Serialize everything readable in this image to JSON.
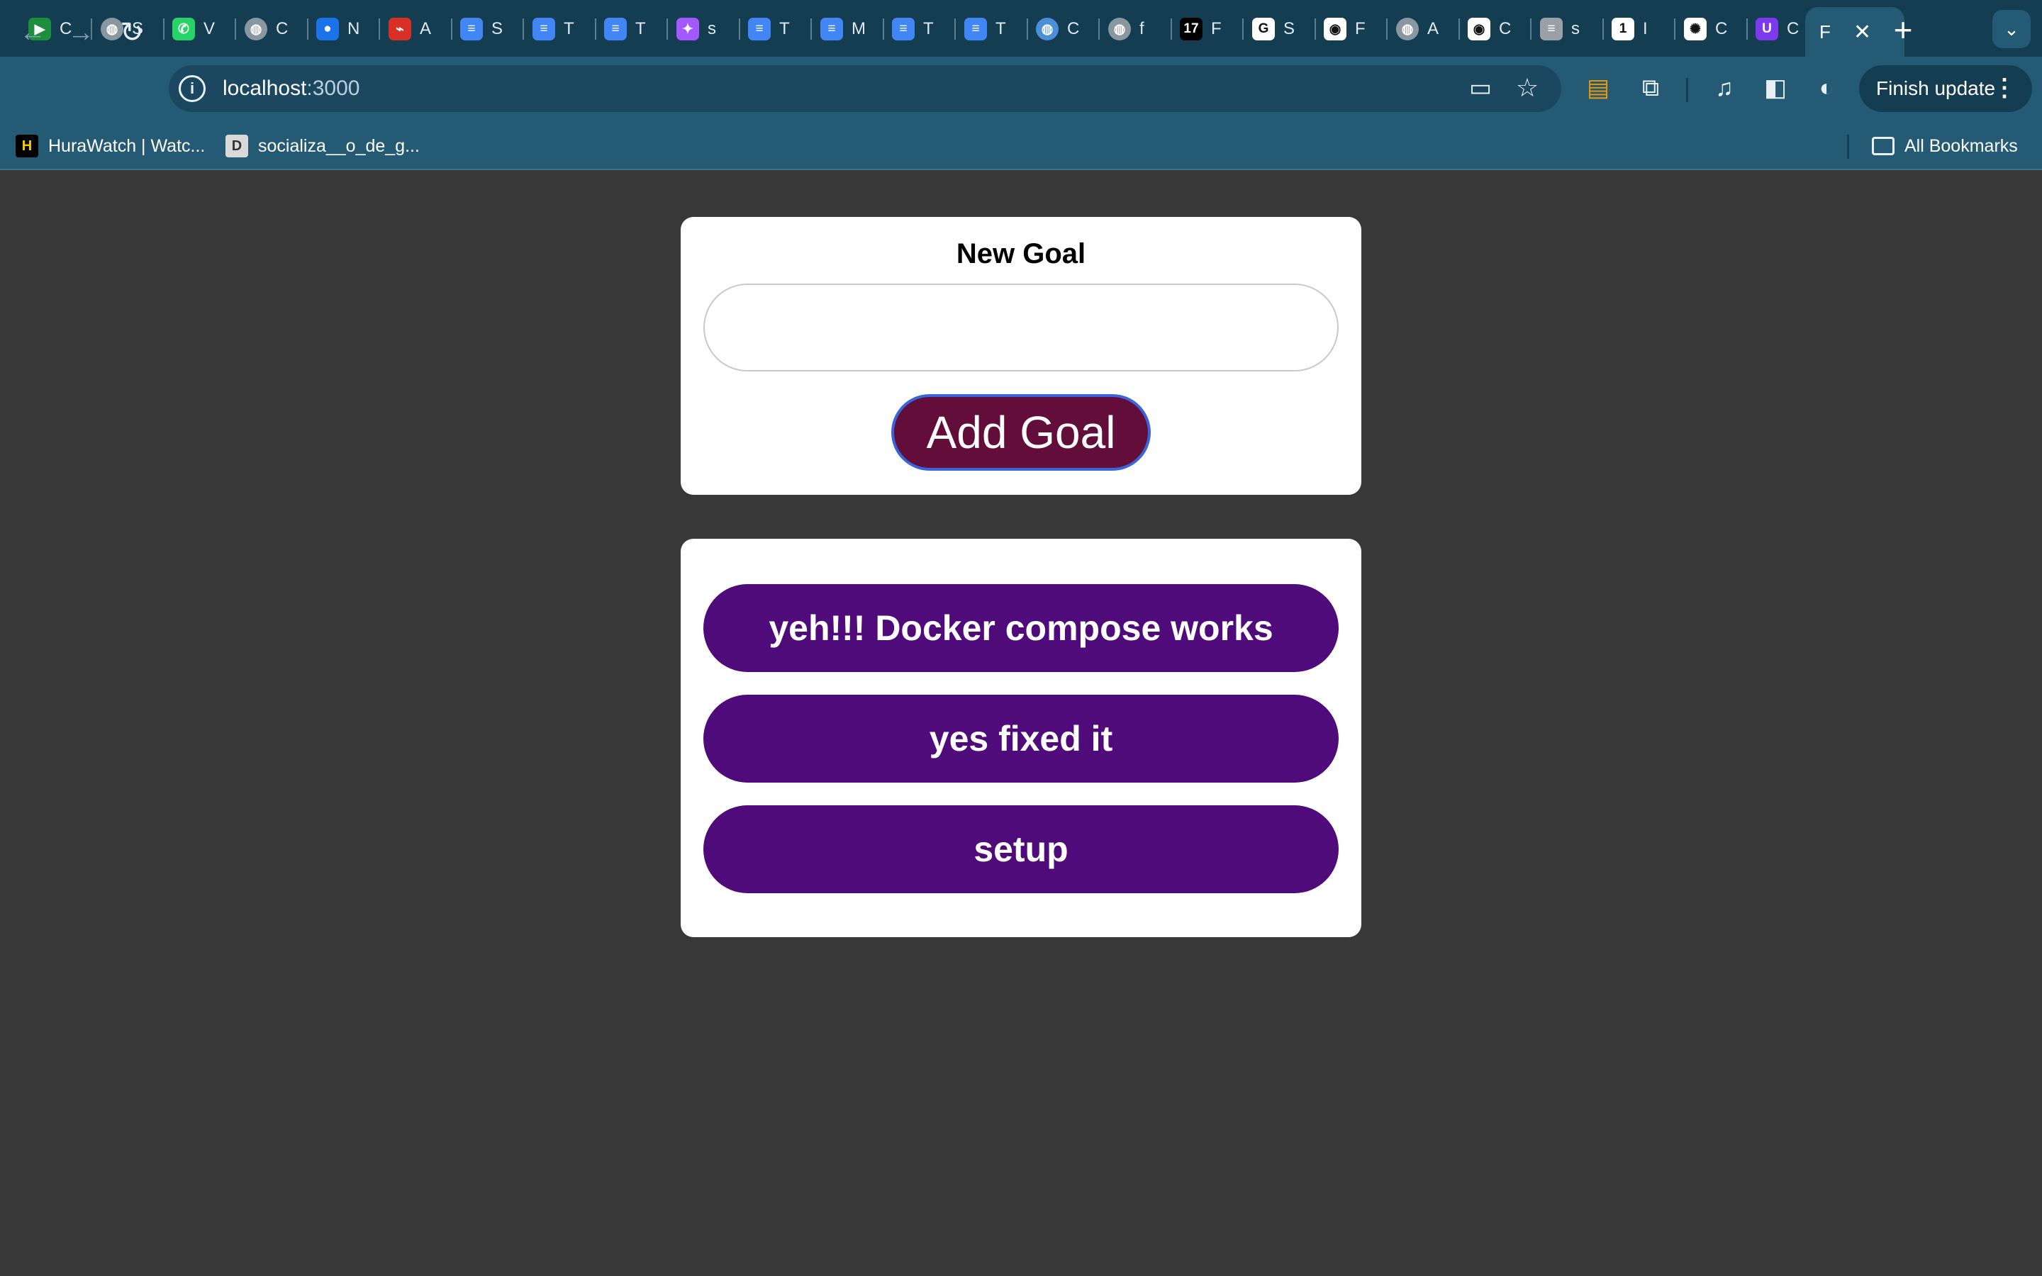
{
  "browser": {
    "tabs": [
      {
        "icon": "google-meet-icon",
        "title": "C",
        "color": "#1e8e3e",
        "glyph": "▶"
      },
      {
        "icon": "globe-icon",
        "title": "S",
        "color": "#8a97a0",
        "glyph": "◍"
      },
      {
        "icon": "whatsapp-icon",
        "title": "V",
        "color": "#25d366",
        "glyph": "✆"
      },
      {
        "icon": "globe-icon",
        "title": "C",
        "color": "#8a97a0",
        "glyph": "◍"
      },
      {
        "icon": "apple-icon",
        "title": "N",
        "color": "#1a73e8",
        "glyph": "●"
      },
      {
        "icon": "airtel-icon",
        "title": "A",
        "color": "#d93025",
        "glyph": "⌁"
      },
      {
        "icon": "docs-icon",
        "title": "S",
        "color": "#4285f4",
        "glyph": "≡"
      },
      {
        "icon": "docs-icon",
        "title": "T",
        "color": "#4285f4",
        "glyph": "≡"
      },
      {
        "icon": "docs-icon",
        "title": "T",
        "color": "#4285f4",
        "glyph": "≡"
      },
      {
        "icon": "figma-icon",
        "title": "s",
        "color": "#a259ff",
        "glyph": "✦"
      },
      {
        "icon": "docs-icon",
        "title": "T",
        "color": "#4285f4",
        "glyph": "≡"
      },
      {
        "icon": "docs-icon",
        "title": "M",
        "color": "#4285f4",
        "glyph": "≡"
      },
      {
        "icon": "docs-icon",
        "title": "T",
        "color": "#4285f4",
        "glyph": "≡"
      },
      {
        "icon": "docs-icon",
        "title": "T",
        "color": "#4285f4",
        "glyph": "≡"
      },
      {
        "icon": "globe-icon",
        "title": "C",
        "color": "#4a8fd8",
        "glyph": "◍"
      },
      {
        "icon": "globe-icon",
        "title": "f",
        "color": "#8a97a0",
        "glyph": "◍"
      },
      {
        "icon": "tradingview-icon",
        "title": "F",
        "color": "#000000",
        "glyph": "17"
      },
      {
        "icon": "google-icon",
        "title": "S",
        "color": "#ffffff",
        "glyph": "G"
      },
      {
        "icon": "github-icon",
        "title": "F",
        "color": "#ffffff",
        "glyph": "◉"
      },
      {
        "icon": "globe-icon",
        "title": "A",
        "color": "#8a97a0",
        "glyph": "◍"
      },
      {
        "icon": "github-icon",
        "title": "C",
        "color": "#ffffff",
        "glyph": "◉"
      },
      {
        "icon": "document-icon",
        "title": "s",
        "color": "#9aa0a6",
        "glyph": "≡"
      },
      {
        "icon": "one-password-icon",
        "title": "I",
        "color": "#ffffff",
        "glyph": "1"
      },
      {
        "icon": "chatgpt-icon",
        "title": "C",
        "color": "#ffffff",
        "glyph": "✺"
      },
      {
        "icon": "ublock-icon",
        "title": "C",
        "color": "#7c3aed",
        "glyph": "U"
      }
    ],
    "active_tab": {
      "title": "F",
      "close": "✕"
    },
    "new_tab": "+",
    "tab_search": "⌄",
    "url_host": "localhost",
    "url_port": ":3000",
    "finish_update": "Finish update",
    "bookmarks": [
      {
        "icon": "hurawatch-icon",
        "label": "HuraWatch | Watc...",
        "glyph": "H"
      },
      {
        "icon": "dictionary-icon",
        "label": "socializa__o_de_g...",
        "glyph": "D"
      }
    ],
    "all_bookmarks": "All Bookmarks"
  },
  "page": {
    "form_title": "New Goal",
    "input_value": "",
    "add_button": "Add Goal",
    "goals": [
      "yeh!!! Docker compose works",
      "yes fixed it",
      "setup"
    ]
  },
  "colors": {
    "page_bg": "#383838",
    "add_button_bg": "#620d3a",
    "goal_item_bg": "#500b7a"
  }
}
